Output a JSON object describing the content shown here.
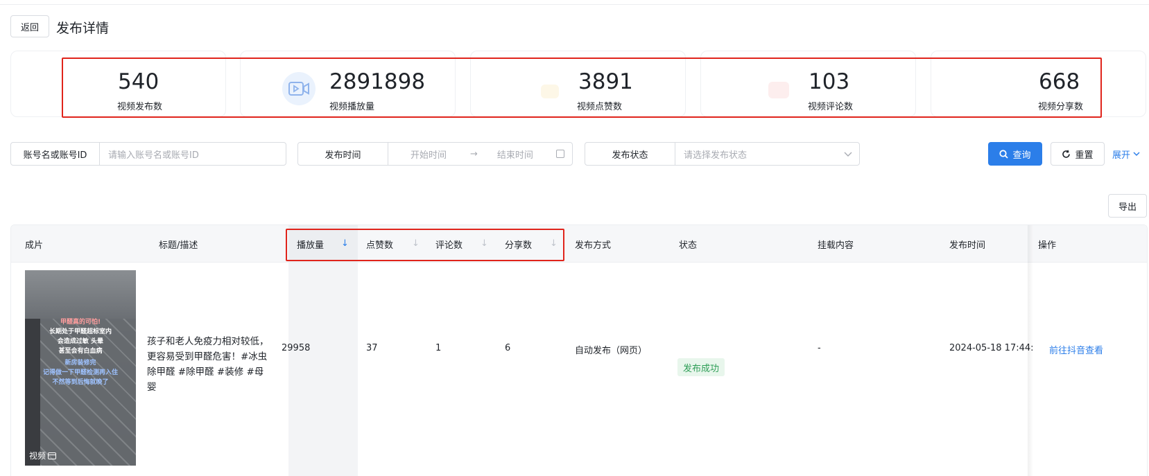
{
  "header": {
    "back_label": "返回",
    "title": "发布详情"
  },
  "stats": [
    {
      "value": "540",
      "label": "视频发布数"
    },
    {
      "value": "2891898",
      "label": "视频播放量"
    },
    {
      "value": "3891",
      "label": "视频点赞数"
    },
    {
      "value": "103",
      "label": "视频评论数"
    },
    {
      "value": "668",
      "label": "视频分享数"
    }
  ],
  "filters": {
    "account_label": "账号名或账号ID",
    "account_placeholder": "请输入账号名或账号ID",
    "time_label": "发布时间",
    "start_placeholder": "开始时间",
    "end_placeholder": "结束时间",
    "status_label": "发布状态",
    "status_placeholder": "请选择发布状态",
    "query_label": "查询",
    "reset_label": "重置",
    "expand_label": "展开",
    "export_label": "导出"
  },
  "table": {
    "headers": [
      "成片",
      "标题/描述",
      "播放量",
      "点赞数",
      "评论数",
      "分享数",
      "发布方式",
      "状态",
      "挂载内容",
      "发布时间",
      "操作"
    ],
    "row": {
      "thumb_lines": [
        "甲醛真的可怕!",
        "长期处于甲醛超标室内",
        "会造成过敏 头晕",
        "甚至会有白血病",
        "新房装修完",
        "记得做一下甲醛检测再入住",
        "不然等到后悔就晚了"
      ],
      "thumb_badge": "视频",
      "description": "孩子和老人免疫力相对较低，更容易受到甲醛危害！#冰虫除甲醛 #除甲醛 #装修 #母婴",
      "plays": "29958",
      "likes": "37",
      "comments": "1",
      "shares": "6",
      "method": "自动发布（网页）",
      "status": "发布成功",
      "mount": "-",
      "time": "2024-05-18 17:44:",
      "action": "前往抖音查看"
    }
  },
  "colors": {
    "accent": "#2b7ee9",
    "highlight": "#e0241b",
    "success": "#2f9e57"
  }
}
